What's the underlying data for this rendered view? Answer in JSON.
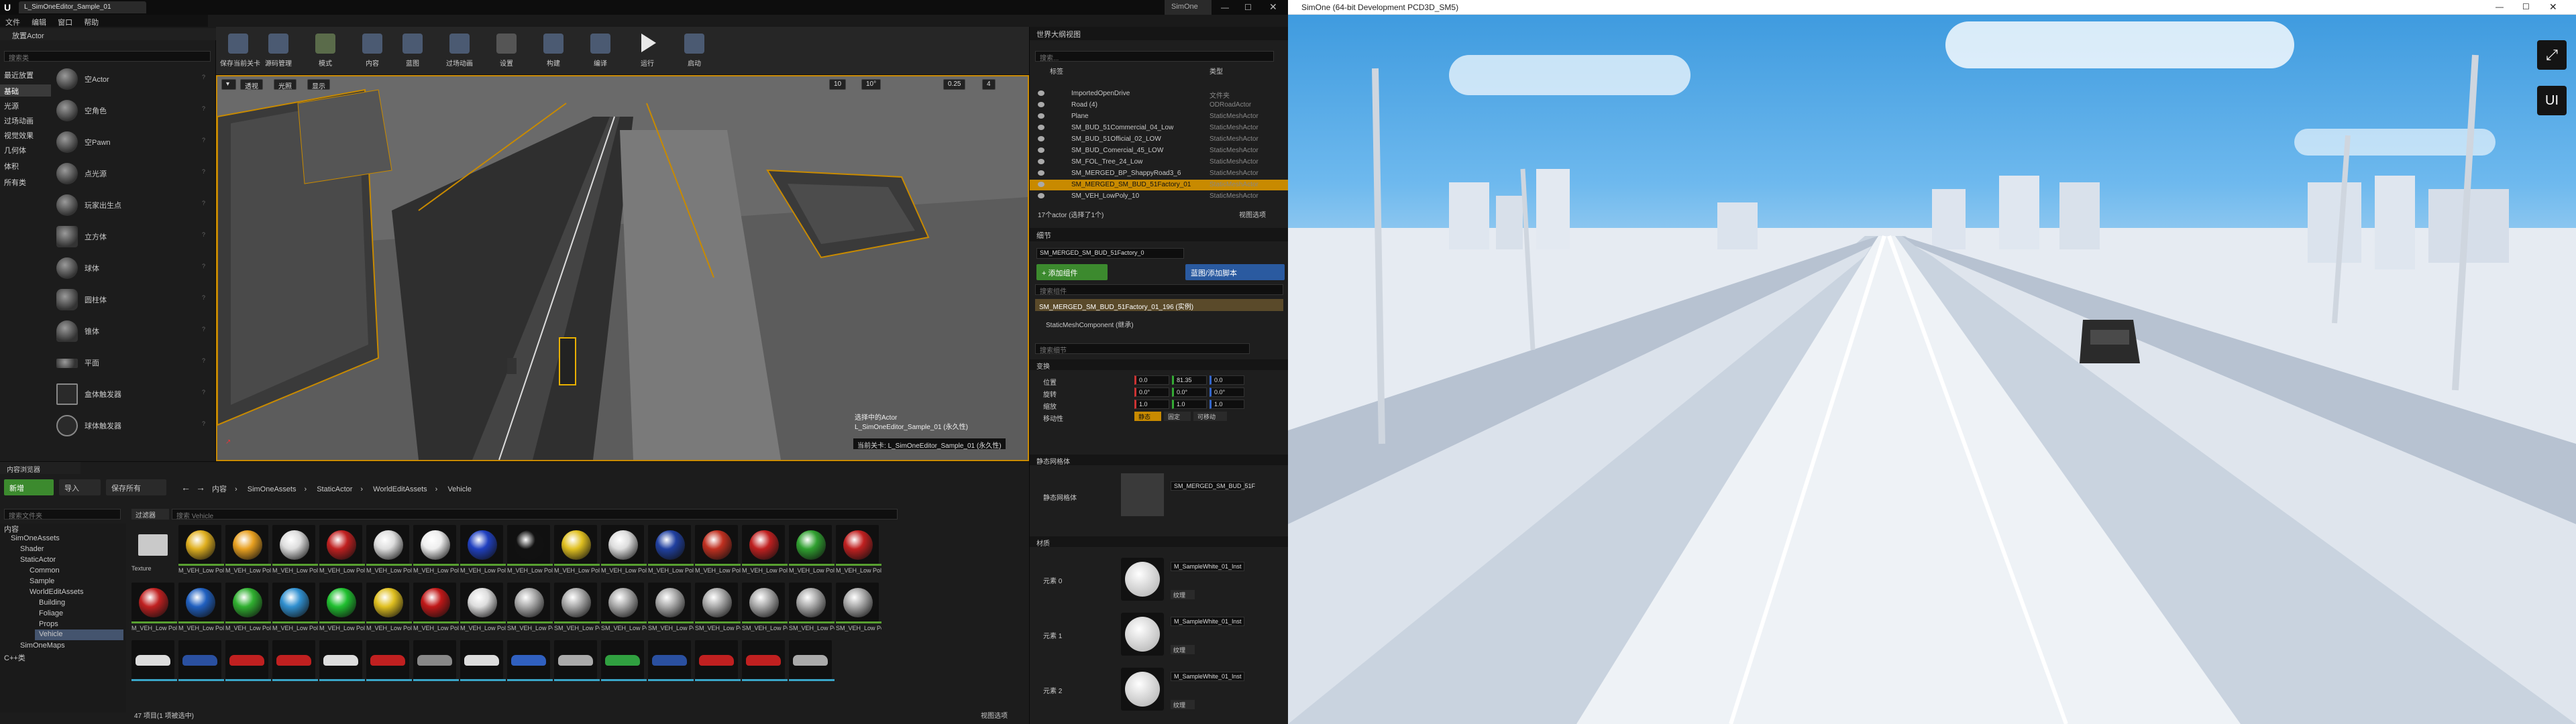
{
  "editor": {
    "title_tab": "L_SimOneEditor_Sample_01",
    "app_name": "SimOne",
    "menu": [
      "文件",
      "编辑",
      "窗口",
      "帮助"
    ],
    "place_tab": "放置Actor",
    "search_placeholder": "搜索类",
    "categories": [
      "最近放置",
      "基础",
      "光源",
      "过场动画",
      "视觉效果",
      "几何体",
      "体积",
      "所有类"
    ],
    "place_items": [
      "空Actor",
      "空角色",
      "空Pawn",
      "点光源",
      "玩家出生点",
      "立方体",
      "球体",
      "圆柱体",
      "锥体",
      "平面",
      "盒体触发器",
      "球体触发器"
    ],
    "toolbar": [
      "保存当前关卡",
      "源码管理",
      "模式",
      "内容",
      "蓝图",
      "过场动画",
      "设置",
      "构建",
      "编译",
      "运行",
      "启动"
    ],
    "viewport": {
      "perspective": "透视",
      "lit": "光照",
      "show": "显示",
      "grid_snap": "10",
      "rot_snap": "10°",
      "scale_snap": "0.25",
      "camera_speed": "4",
      "level_info": "当前关卡:",
      "level_name": "L_SimOneEditor_Sample_01 (永久性)",
      "bottom_note": "选择中的Actor",
      "bottom_note2": "L_SimOneEditor_Sample_01 (永久性)"
    },
    "outliner": {
      "title": "世界大纲视图",
      "search_placeholder": "搜索...",
      "col_label": "标签",
      "col_type": "类型",
      "rows": [
        {
          "label": "ImportedOpenDrive",
          "type": "文件夹"
        },
        {
          "label": "Road (4)",
          "type": "ODRoadActor"
        },
        {
          "label": "Plane",
          "type": "StaticMeshActor"
        },
        {
          "label": "SM_BUD_51Commercial_04_Low",
          "type": "StaticMeshActor"
        },
        {
          "label": "SM_BUD_51Official_02_LOW",
          "type": "StaticMeshActor"
        },
        {
          "label": "SM_BUD_Comercial_45_LOW",
          "type": "StaticMeshActor"
        },
        {
          "label": "SM_FOL_Tree_24_Low",
          "type": "StaticMeshActor"
        },
        {
          "label": "SM_MERGED_BP_ShappyRoad3_6",
          "type": "StaticMeshActor"
        },
        {
          "label": "SM_MERGED_SM_BUD_51Factory_01",
          "type": "StaticMeshActor"
        },
        {
          "label": "SM_VEH_LowPoly_10",
          "type": "StaticMeshActor"
        }
      ],
      "footer": "17个actor (选择了1个)",
      "view_options": "视图选项"
    },
    "details": {
      "title": "细节",
      "name_value": "SM_MERGED_SM_BUD_51Factory_0",
      "add_component": "+ 添加组件",
      "blueprint": "蓝图/添加脚本",
      "search_components": "搜索组件",
      "selected_component": "SM_MERGED_SM_BUD_51Factory_01_196 (实例)",
      "child_component": "StaticMeshComponent (继承)",
      "search_details": "搜索细节",
      "transform": "变换",
      "location": "位置",
      "rotation": "旋转",
      "scale": "缩放",
      "mobility": "移动性",
      "loc": [
        "0.0",
        "81.35",
        "0.0"
      ],
      "rot": [
        "0.0°",
        "0.0°",
        "0.0°"
      ],
      "scl": [
        "1.0",
        "1.0",
        "1.0"
      ],
      "mob": [
        "静态",
        "固定",
        "可移动"
      ],
      "static_mesh_section": "静态网格体",
      "static_mesh_label": "静态网格体",
      "static_mesh_value": "SM_MERGED_SM_BUD_51F",
      "materials": "材质",
      "element0": "元素 0",
      "element1": "元素 1",
      "element2": "元素 2",
      "mat0": "M_SampleWhite_01_Inst",
      "mat1": "M_SampleWhite_01_Inst",
      "mat2": "M_SampleWhite_01_Inst",
      "texture_btn": "纹理"
    },
    "content": {
      "tab": "内容浏览器",
      "add_new": "新增",
      "import": "导入",
      "save_all": "保存所有",
      "breadcrumb": [
        "内容",
        "SimOneAssets",
        "StaticActor",
        "WorldEditAssets",
        "Vehicle"
      ],
      "tree_search": "搜索文件夹",
      "tree": [
        "内容",
        "SimOneAssets",
        "Shader",
        "StaticActor",
        "Common",
        "Sample",
        "WorldEditAssets",
        "Building",
        "Foliage",
        "Props",
        "Vehicle",
        "SimOneMaps",
        "C++类"
      ],
      "filter": "过滤器",
      "asset_search": "搜索 Vehicle",
      "folder_name": "Texture",
      "status": "47 项目(1 项被选中)",
      "view_options": "视图选项",
      "row1": [
        "M_VEH_Low Poly_01_Inst",
        "M_VEH_Low Poly_02_Inst",
        "M_VEH_Low Poly_03_Inst",
        "M_VEH_Low Poly_04_Inst",
        "M_VEH_Low Poly_05_Inst",
        "M_VEH_Low Poly_06_Inst",
        "M_VEH_Low Poly_07_Inst",
        "M_VEH_Low Poly_08_Inst",
        "M_VEH_Low Poly_09_Inst",
        "M_VEH_Low Poly_10_Inst",
        "M_VEH_Low Poly_11_Inst",
        "M_VEH_Low Poly_12_Inst",
        "M_VEH_Low Poly_13_Inst",
        "M_VEH_Low Poly_14_Inst",
        "M_VEH_Low Poly_15_Inst"
      ],
      "row2": [
        "M_VEH_Low Poly_16_Inst",
        "M_VEH_Low Poly_17_Inst",
        "M_VEH_Low Poly_18_Inst",
        "M_VEH_Low Poly_19_Inst",
        "M_VEH_Low Poly_20_Inst",
        "M_VEH_Low Poly_21_Inst",
        "M_VEH_Low Poly_22_Inst",
        "M_VEH_Low Poly_23_Inst",
        "SM_VEH_Low Poly_10",
        "SM_VEH_Low Poly_11",
        "SM_VEH_Low Poly_12",
        "SM_VEH_Low Poly_13",
        "SM_VEH_Low Poly_14",
        "SM_VEH_Low Poly_15",
        "SM_VEH_Low Poly_16",
        "SM_VEH_Low Poly_17"
      ]
    }
  },
  "simone": {
    "title": "SimOne (64-bit Development PCD3D_SM5)",
    "ui_button": "UI"
  },
  "colors": {
    "accent": "#c88a00",
    "green_btn": "#3c8a2e",
    "blue_btn": "#2a5aa0"
  }
}
